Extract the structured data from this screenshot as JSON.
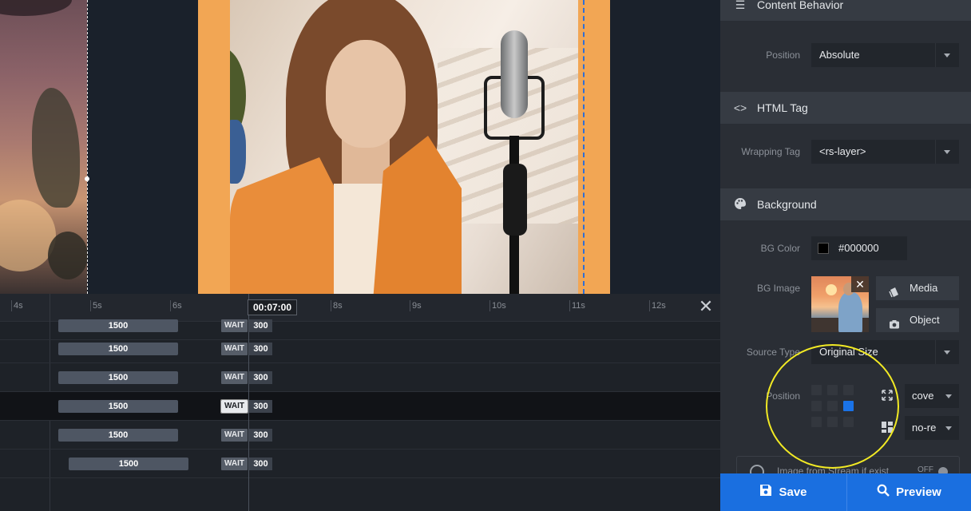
{
  "timeline": {
    "ticks": [
      "4s",
      "5s",
      "6s",
      "8s",
      "9s",
      "10s",
      "11s",
      "12s"
    ],
    "current_time": "00:07:00",
    "rows": [
      {
        "duration": "1500",
        "wait": "WAIT",
        "wait_value": "300",
        "selected": false
      },
      {
        "duration": "1500",
        "wait": "WAIT",
        "wait_value": "300",
        "selected": false
      },
      {
        "duration": "1500",
        "wait": "WAIT",
        "wait_value": "300",
        "selected": false
      },
      {
        "duration": "1500",
        "wait": "WAIT",
        "wait_value": "300",
        "selected": true
      },
      {
        "duration": "1500",
        "wait": "WAIT",
        "wait_value": "300",
        "selected": false
      },
      {
        "duration": "1500",
        "wait": "WAIT",
        "wait_value": "300",
        "selected": false
      }
    ]
  },
  "panel": {
    "content_behavior": {
      "title": "Content Behavior",
      "position_label": "Position",
      "position_value": "Absolute"
    },
    "html_tag": {
      "title": "HTML Tag",
      "wrapping_label": "Wrapping Tag",
      "wrapping_value": "<rs-layer>"
    },
    "background": {
      "title": "Background",
      "bg_color_label": "BG Color",
      "bg_color_value": "#000000",
      "bg_color_swatch": "#000000",
      "bg_image_label": "BG Image",
      "media_label": "Media",
      "object_label": "Object",
      "source_type_label": "Source Type",
      "source_type_value": "Original Size",
      "position_label": "Position",
      "size_value": "cove",
      "repeat_value": "no-re",
      "stream_label": "Image from Stream if exist",
      "stream_toggle": "OFF"
    }
  },
  "actions": {
    "save_label": "Save",
    "preview_label": "Preview"
  },
  "colors": {
    "accent": "#1a6fe0",
    "layer_bg": "#f2a654",
    "annotation": "#f2ea24"
  }
}
